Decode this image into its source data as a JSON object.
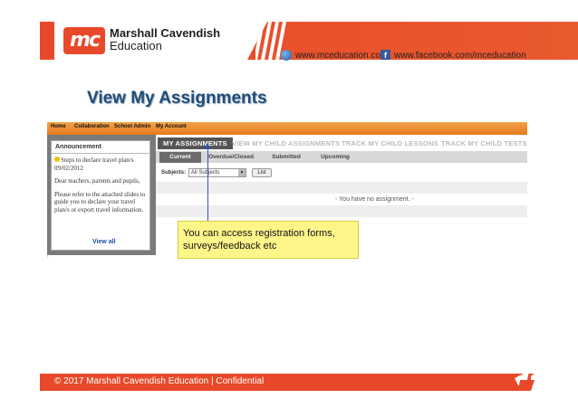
{
  "header": {
    "logo_initials": "mc",
    "logo_line1": "Marshall Cavendish",
    "logo_line2": "Education",
    "website": "www.mceducation.com",
    "facebook": "www.facebook.com/mceducation",
    "brand_color": "#e8492a"
  },
  "title": "View My Assignments",
  "app": {
    "topnav": [
      "Home",
      "Collaboration",
      "School Admin",
      "My Account"
    ],
    "announcement": {
      "heading": "Announcement",
      "item_title": "Steps to declare travel plan/s 09/02/2012",
      "p1": "Dear teachers, parents and pupils,",
      "p2": "Please refer to the attached slides to guide you to declare your travel plan/s or export travel information.",
      "view_all": "View all"
    },
    "tabs": [
      "MY ASSIGNMENTS",
      "VIEW MY CHILD ASSIGNMENTS",
      "TRACK MY CHILD LESSONS",
      "TRACK MY CHILD TESTS"
    ],
    "subtabs": [
      "Current",
      "Overdue/Closed",
      "Submitted",
      "Upcoming"
    ],
    "subjects_label": "Subjects:",
    "subjects_value": "All Subjects",
    "list_button": "List",
    "no_assignment": "- You have no assignment. -"
  },
  "callout": {
    "line1": "You can access registration forms,",
    "line2": "surveys/feedback etc"
  },
  "footer": {
    "text": "© 2017 Marshall Cavendish Education | Confidential"
  }
}
